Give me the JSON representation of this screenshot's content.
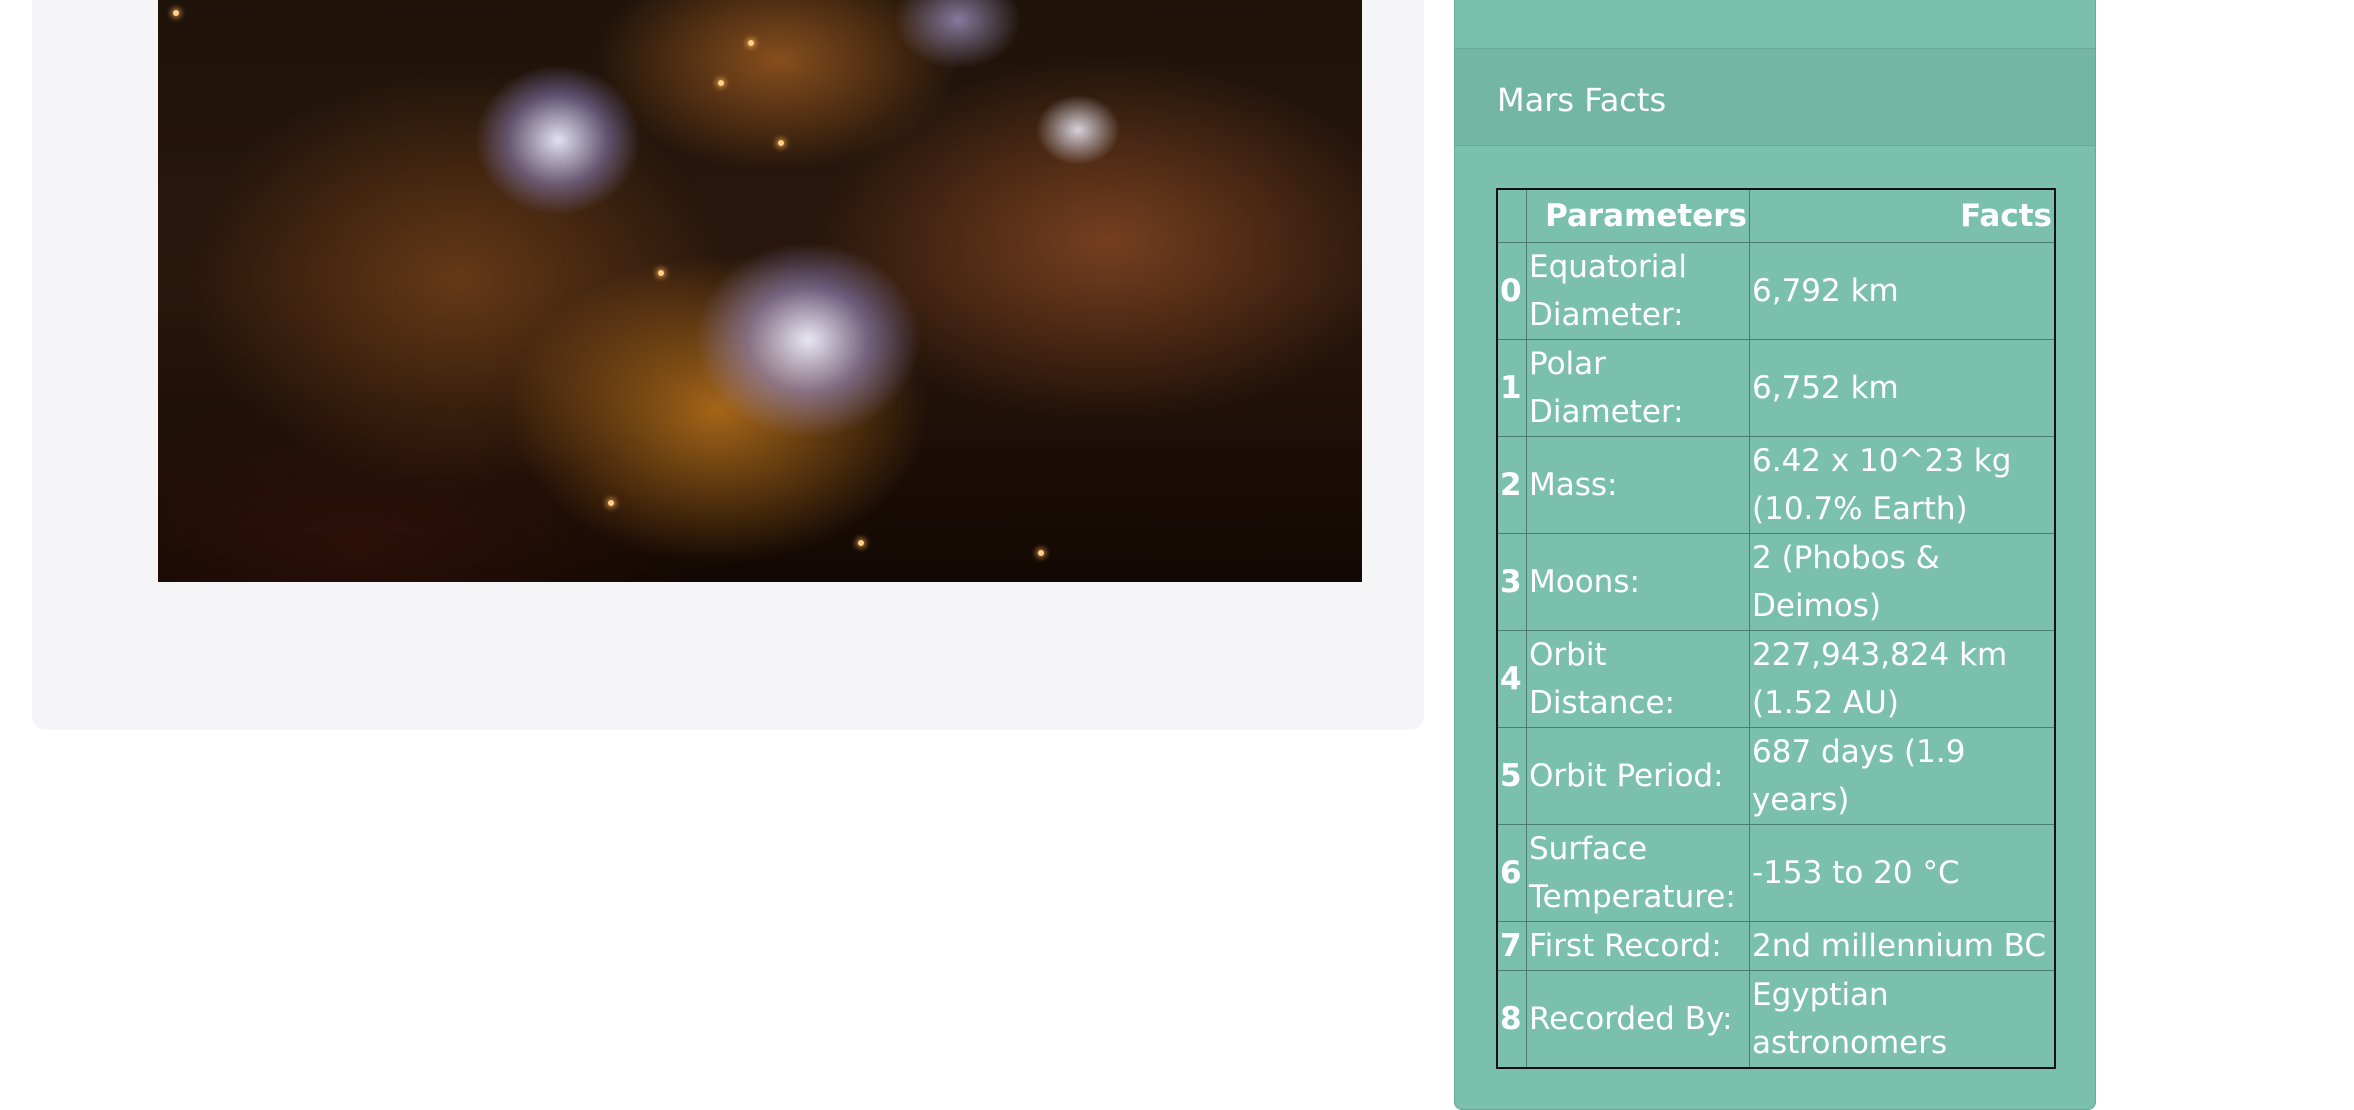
{
  "image_panel": {
    "image_description": "space-nebula-image"
  },
  "facts_card": {
    "header": "Mars Facts",
    "table": {
      "columns": [
        "",
        "Parameters",
        "Facts"
      ],
      "rows": [
        {
          "index": "0",
          "parameter": "Equatorial Diameter:",
          "fact": "6,792 km"
        },
        {
          "index": "1",
          "parameter": "Polar Diameter:",
          "fact": "6,752 km"
        },
        {
          "index": "2",
          "parameter": "Mass:",
          "fact": "6.42 x 10^23 kg (10.7% Earth)"
        },
        {
          "index": "3",
          "parameter": "Moons:",
          "fact": "2 (Phobos & Deimos)"
        },
        {
          "index": "4",
          "parameter": "Orbit Distance:",
          "fact": "227,943,824 km (1.52 AU)"
        },
        {
          "index": "5",
          "parameter": "Orbit Period:",
          "fact": "687 days (1.9 years)"
        },
        {
          "index": "6",
          "parameter": "Surface Temperature:",
          "fact": "-153 to 20 °C"
        },
        {
          "index": "7",
          "parameter": "First Record:",
          "fact": "2nd millennium BC"
        },
        {
          "index": "8",
          "parameter": "Recorded By:",
          "fact": "Egyptian astronomers"
        }
      ]
    }
  },
  "colors": {
    "card_background": "#7bc0ac",
    "panel_background": "#f5f5f7",
    "text": "#ffffff"
  }
}
